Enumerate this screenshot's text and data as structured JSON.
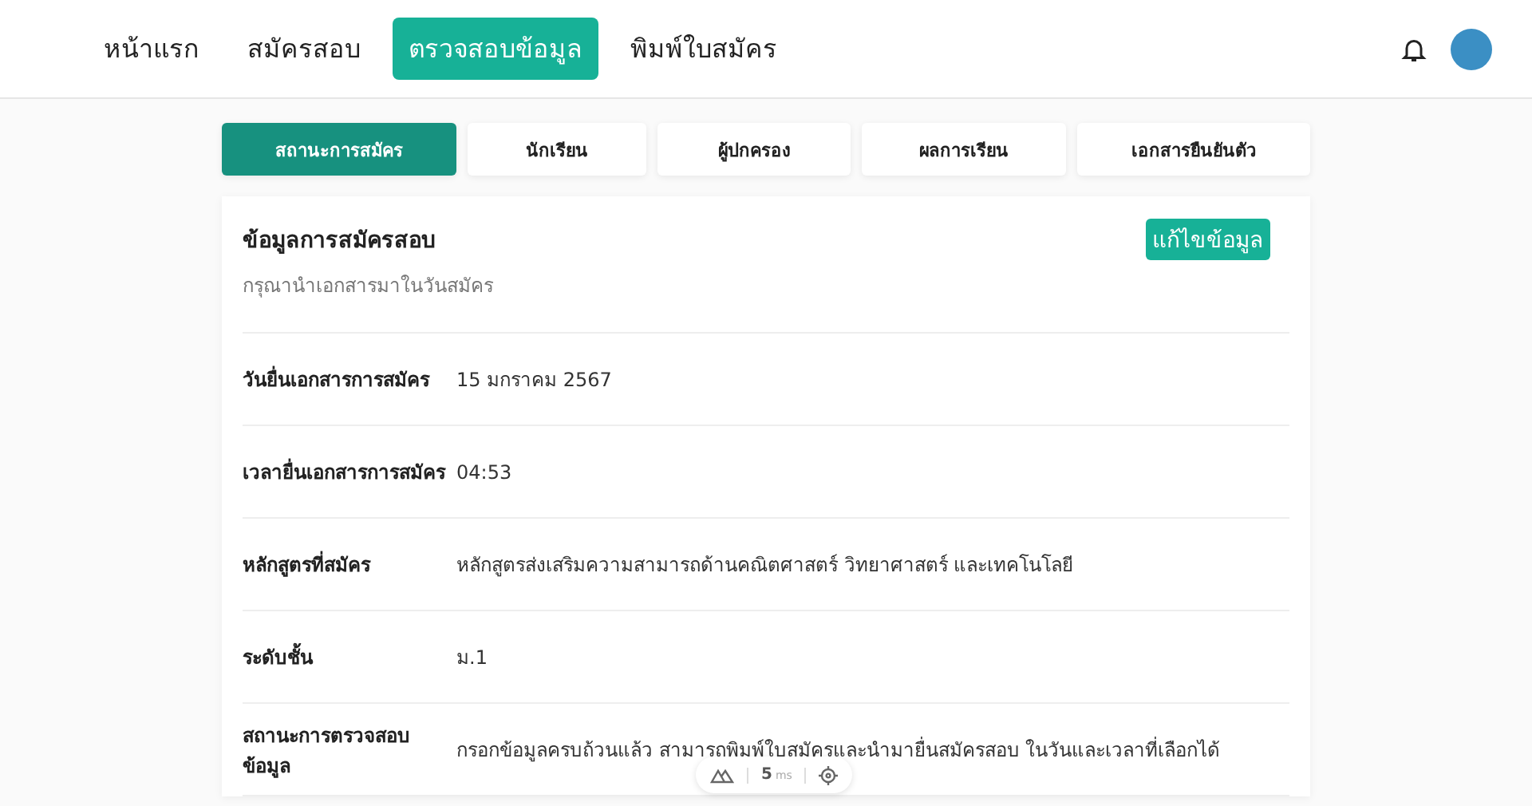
{
  "nav": {
    "items": [
      {
        "label": "หน้าแรก",
        "selected": false
      },
      {
        "label": "สมัครสอบ",
        "selected": false
      },
      {
        "label": "ตรวจสอบข้อมูล",
        "selected": true
      },
      {
        "label": "พิมพ์ใบสมัคร",
        "selected": false
      }
    ]
  },
  "tabs": [
    {
      "label": "สถานะการสมัคร",
      "selected": true
    },
    {
      "label": "นักเรียน",
      "selected": false
    },
    {
      "label": "ผู้ปกครอง",
      "selected": false
    },
    {
      "label": "ผลการเรียน",
      "selected": false
    },
    {
      "label": "เอกสารยืนยันตัว",
      "selected": false
    }
  ],
  "card": {
    "title": "ข้อมูลการสมัครสอบ",
    "subtitle": "กรุณานำเอกสารมาในวันสมัคร",
    "edit_button": "แก้ไขข้อมูล",
    "rows": [
      {
        "label": "วันยื่นเอกสารการสมัคร",
        "value": "15 มกราคม 2567"
      },
      {
        "label": "เวลายื่นเอกสารการสมัคร",
        "value": "04:53"
      },
      {
        "label": "หลักสูตรที่สมัคร",
        "value": "หลักสูตรส่งเสริมความสามารถด้านคณิตศาสตร์ วิทยาศาสตร์ และเทคโนโลยี"
      },
      {
        "label": "ระดับชั้น",
        "value": "ม.1"
      },
      {
        "label": "สถานะการตรวจสอบข้อมูล",
        "value": "กรอกข้อมูลครบถ้วนแล้ว สามารถพิมพ์ใบสมัครและนำมายื่นสมัครสอบ ในวันและเวลาที่เลือกได้"
      }
    ]
  },
  "devtools": {
    "time": "5",
    "unit": "ms"
  }
}
